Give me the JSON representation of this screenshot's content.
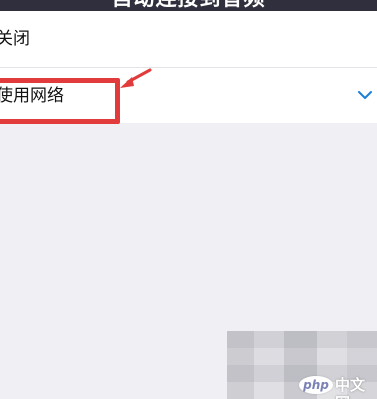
{
  "header": {
    "title": "自动连接到音频"
  },
  "options": [
    {
      "label": "关闭",
      "selected": false
    },
    {
      "label": "使用网络",
      "selected": true
    }
  ],
  "icons": {
    "selected_check": "checkmark-icon",
    "annotation_arrow": "arrow-icon"
  },
  "colors": {
    "header_bg": "#2f2f3d",
    "check": "#1e7fd6",
    "annotation": "#e23b3b",
    "background": "#efeff4"
  },
  "watermark": {
    "logo": "php",
    "site": "中文网"
  }
}
